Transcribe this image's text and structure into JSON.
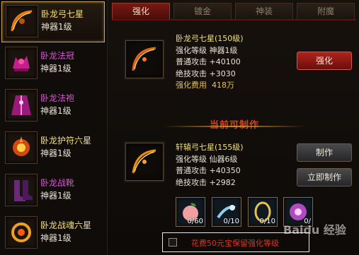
{
  "sidebar": {
    "items": [
      {
        "name": "卧龙弓七星",
        "sub": "神器1级",
        "name_color": "#f2e07a",
        "selected": true,
        "icon": "bow-icon"
      },
      {
        "name": "卧龙法冠",
        "sub": "神器1级",
        "name_color": "#e04fd8",
        "icon": "crown-icon"
      },
      {
        "name": "卧龙法袍",
        "sub": "神器1级",
        "name_color": "#e04fd8",
        "icon": "robe-icon"
      },
      {
        "name": "卧龙护符六星",
        "sub": "神器1级",
        "name_color": "#f2e07a",
        "icon": "amulet-icon"
      },
      {
        "name": "卧龙战靴",
        "sub": "神器1级",
        "name_color": "#e04fd8",
        "icon": "boots-icon"
      },
      {
        "name": "卧龙战魂六星",
        "sub": "神器1级",
        "name_color": "#f2e07a",
        "icon": "soul-ring-icon"
      }
    ]
  },
  "tabs": [
    "强化",
    "镀金",
    "神装",
    "附魔"
  ],
  "current": {
    "name": "卧龙弓七星(150级)",
    "level": "强化等级  神器1级",
    "normal_attack": "普通攻击  +40100",
    "skill_attack": "绝技攻击  +3030",
    "cost_label": "强化费用",
    "cost_value": "418万",
    "enhance_button": "强化"
  },
  "section_title": "当前可制作",
  "craftable": {
    "name": "轩辕弓七星(155级)",
    "level": "强化等级  仙器6级",
    "normal_attack": "普通攻击  +40350",
    "skill_attack": "绝技攻击  +2982",
    "craft_button": "制作",
    "instant_button": "立即制作"
  },
  "materials": [
    {
      "count": "0/60",
      "icon": "peach-icon"
    },
    {
      "count": "0/10",
      "icon": "water-icon"
    },
    {
      "count": "0/10",
      "icon": "ring-icon"
    },
    {
      "count": "0/",
      "icon": "spirit-icon"
    }
  ],
  "keep_option": {
    "label": "花费50元宝保留强化等级",
    "checked": false
  },
  "watermark": "Baidu 经验",
  "colors": {
    "accent_red": "#7a1814",
    "gold_text": "#f2e07a",
    "purple_text": "#e04fd8"
  }
}
